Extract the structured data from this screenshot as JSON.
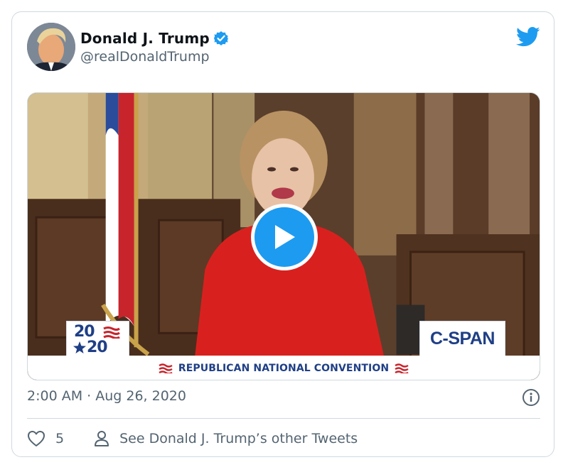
{
  "tweet": {
    "author_name": "Donald J. Trump",
    "handle": "@realDonaldTrump",
    "timestamp": "2:00 AM · Aug 26, 2020",
    "likes": "5",
    "see_more": "See Donald J. Trump’s other Tweets"
  },
  "media": {
    "logo_2020_top": "20",
    "logo_2020_bottom": "20",
    "network": "C-SPAN",
    "banner": "REPUBLICAN NATIONAL CONVENTION"
  },
  "colors": {
    "accent": "#1d9bf0",
    "text_secondary": "#536471",
    "border": "#cfd9de",
    "jacket_red": "#d8211e",
    "convention_blue": "#1f3f86"
  },
  "icons": [
    "verified-badge-icon",
    "twitter-bird-icon",
    "play-icon",
    "info-icon",
    "heart-icon",
    "person-icon"
  ]
}
